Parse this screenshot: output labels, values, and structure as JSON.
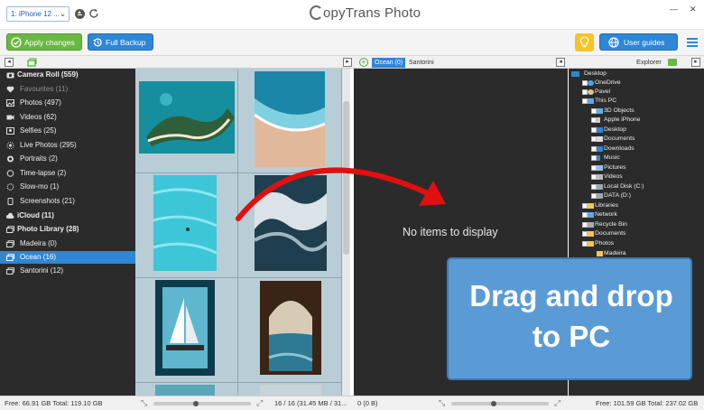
{
  "window": {
    "app_title": "opyTrans Photo",
    "app_title_letter": "C",
    "minimize": "—",
    "close": "✕"
  },
  "device": {
    "selected": "1: iPhone 12 ..."
  },
  "toolbar": {
    "apply_label": "Apply changes",
    "backup_label": "Full Backup",
    "guides_label": "User guides"
  },
  "tabs": [
    {
      "label": "Ocean (0)"
    },
    {
      "label": "Santorini"
    }
  ],
  "explorer_label": "Explorer",
  "sidebar": {
    "items": [
      {
        "label": "Camera Roll (559)"
      },
      {
        "label": "Favourites (11)"
      },
      {
        "label": "Photos (497)"
      },
      {
        "label": "Videos (62)"
      },
      {
        "label": "Selfies (25)"
      },
      {
        "label": "Live Photos (295)"
      },
      {
        "label": "Portraits (2)"
      },
      {
        "label": "Time-lapse (2)"
      },
      {
        "label": "Slow-mo (1)"
      },
      {
        "label": "Screenshots (21)"
      },
      {
        "label": "iCloud (11)"
      },
      {
        "label": "Photo Library (28)"
      },
      {
        "label": "Madeira (0)"
      },
      {
        "label": "Ocean (16)"
      },
      {
        "label": "Santorini (12)"
      }
    ]
  },
  "middle": {
    "empty_text": "No items to display"
  },
  "tree": [
    {
      "label": "Desktop"
    },
    {
      "label": "OneDrive"
    },
    {
      "label": "Pavel"
    },
    {
      "label": "This PC"
    },
    {
      "label": "3D Objects"
    },
    {
      "label": "Apple iPhone"
    },
    {
      "label": "Desktop"
    },
    {
      "label": "Documents"
    },
    {
      "label": "Downloads"
    },
    {
      "label": "Music"
    },
    {
      "label": "Pictures"
    },
    {
      "label": "Videos"
    },
    {
      "label": "Local Disk (C:)"
    },
    {
      "label": "DATA (D:)"
    },
    {
      "label": "Libraries"
    },
    {
      "label": "Network"
    },
    {
      "label": "Recycle Bin"
    },
    {
      "label": "Documents"
    },
    {
      "label": "Photos"
    },
    {
      "label": "Madeira"
    }
  ],
  "callout": {
    "line1": "Drag and drop",
    "line2": "to PC"
  },
  "status": {
    "left": "Free: 66.91 GB Total: 119.10 GB",
    "thumbs": "16 / 16 (31.45 MB / 31...",
    "middle": "0 (0 B)",
    "right": "Free: 101.59 GB Total: 237.02 GB"
  },
  "colors": {
    "accent": "#2e86d4",
    "green": "#6ab744",
    "panel": "#2b2b2b",
    "callout": "#5b9bd5",
    "arrow": "#e01010"
  }
}
